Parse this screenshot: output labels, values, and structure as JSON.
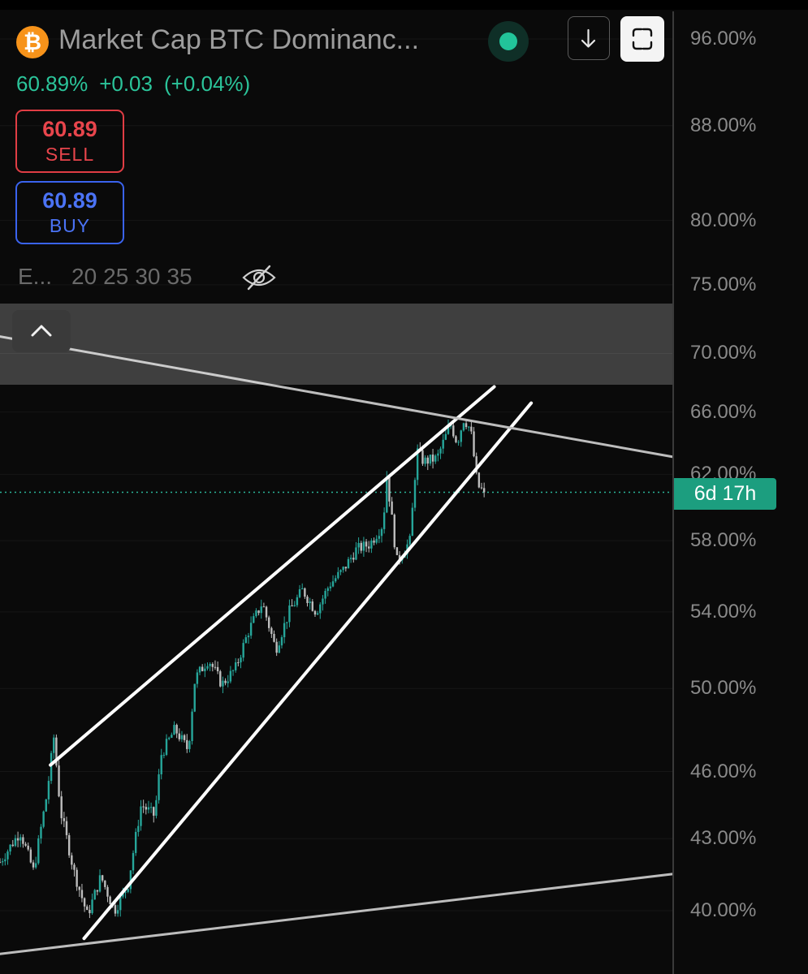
{
  "header": {
    "title": "Market Cap BTC Dominanc...",
    "coin_icon_glyph": "₿",
    "coin_icon": "bitcoin-icon",
    "status_color": "#22c49a",
    "price_pct": "60.89%",
    "change_abs": "+0.03",
    "change_pct": "(+0.04%)",
    "up_color": "#2bc49a"
  },
  "trade": {
    "sell_value": "60.89",
    "sell_label": "SELL",
    "buy_value": "60.89",
    "buy_label": "BUY"
  },
  "indicators": {
    "label": "E...",
    "periods": [
      "20",
      "25",
      "30",
      "35"
    ],
    "visibility_icon": "eye-off-icon"
  },
  "toolbar": {
    "download_icon": "arrow-down-icon",
    "fullscreen_icon": "fullscreen-icon",
    "collapse_icon": "chevron-up-icon"
  },
  "price_axis": {
    "labels": [
      "96.00%",
      "88.00%",
      "80.00%",
      "75.00%",
      "70.00%",
      "66.00%",
      "62.00%",
      "58.00%",
      "54.00%",
      "50.00%",
      "46.00%",
      "43.00%",
      "40.00%"
    ],
    "countdown": "6d 17h",
    "countdown_color": "#1c9e7f"
  },
  "chart_data": {
    "type": "candlestick",
    "scale": "log",
    "last_price": 60.89,
    "ylim": [
      38.5,
      97
    ],
    "up_color": "#26a69a",
    "down_color": "#bdbdbd",
    "trendlines": [
      {
        "name": "channel upper",
        "from": [
          0.075,
          46.3
        ],
        "to": [
          0.735,
          67.7
        ]
      },
      {
        "name": "channel lower",
        "from": [
          0.125,
          38.9
        ],
        "to": [
          0.79,
          66.6
        ]
      },
      {
        "name": "long-term resistance",
        "from": [
          0,
          71.2
        ],
        "to": [
          1,
          63.1
        ]
      },
      {
        "name": "long-term support",
        "from": [
          0,
          38.3
        ],
        "to": [
          1,
          41.5
        ]
      }
    ],
    "close_path": [
      [
        0.0,
        42.0
      ],
      [
        0.03,
        43.3
      ],
      [
        0.05,
        41.6
      ],
      [
        0.07,
        45.0
      ],
      [
        0.08,
        47.6
      ],
      [
        0.09,
        44.2
      ],
      [
        0.11,
        41.6
      ],
      [
        0.13,
        39.8
      ],
      [
        0.15,
        41.4
      ],
      [
        0.17,
        40.0
      ],
      [
        0.19,
        41.0
      ],
      [
        0.21,
        44.5
      ],
      [
        0.23,
        44.0
      ],
      [
        0.24,
        46.8
      ],
      [
        0.26,
        48.0
      ],
      [
        0.28,
        47.0
      ],
      [
        0.29,
        50.5
      ],
      [
        0.31,
        51.5
      ],
      [
        0.33,
        50.2
      ],
      [
        0.35,
        51.0
      ],
      [
        0.37,
        53.0
      ],
      [
        0.39,
        54.5
      ],
      [
        0.41,
        52.0
      ],
      [
        0.43,
        54.0
      ],
      [
        0.45,
        55.2
      ],
      [
        0.47,
        54.0
      ],
      [
        0.49,
        55.5
      ],
      [
        0.51,
        56.3
      ],
      [
        0.53,
        57.5
      ],
      [
        0.55,
        57.8
      ],
      [
        0.57,
        59.0
      ],
      [
        0.575,
        62.0
      ],
      [
        0.59,
        56.8
      ],
      [
        0.61,
        58.0
      ],
      [
        0.62,
        63.5
      ],
      [
        0.63,
        62.8
      ],
      [
        0.65,
        63.0
      ],
      [
        0.67,
        65.2
      ],
      [
        0.68,
        64.0
      ],
      [
        0.69,
        65.6
      ],
      [
        0.7,
        64.8
      ],
      [
        0.71,
        61.3
      ],
      [
        0.72,
        60.89
      ]
    ]
  }
}
